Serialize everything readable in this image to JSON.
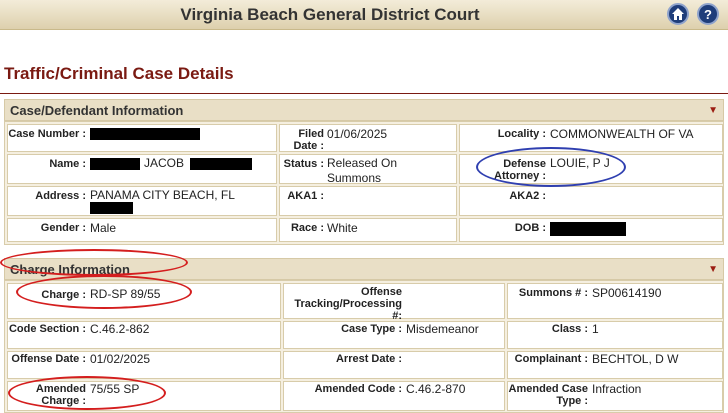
{
  "header": {
    "court_name": "Virginia Beach General District Court",
    "home_icon": "home-icon",
    "help_icon": "?"
  },
  "page_title": "Traffic/Criminal Case Details",
  "case_section": {
    "title": "Case/Defendant Information",
    "case_number_label": "Case Number :",
    "filed_date_label": "Filed Date :",
    "filed_date": "01/06/2025",
    "locality_label": "Locality :",
    "locality": "COMMONWEALTH OF VA",
    "name_label": "Name :",
    "name_visible": "JACOB",
    "status_label": "Status :",
    "status": "Released On Summons",
    "defense_label": "Defense Attorney :",
    "defense": "LOUIE, P J",
    "address_label": "Address :",
    "address": "PANAMA CITY BEACH, FL",
    "aka1_label": "AKA1 :",
    "aka2_label": "AKA2 :",
    "gender_label": "Gender :",
    "gender": "Male",
    "race_label": "Race :",
    "race": "White",
    "dob_label": "DOB :"
  },
  "charge_section": {
    "title": "Charge Information",
    "charge_label": "Charge :",
    "charge": "RD-SP 89/55",
    "offense_tracking_label": "Offense Tracking/Processing #:",
    "summons_label": "Summons # :",
    "summons": "SP00614190",
    "code_section_label": "Code Section :",
    "code_section": "C.46.2-862",
    "case_type_label": "Case Type :",
    "case_type": "Misdemeanor",
    "class_label": "Class :",
    "class": "1",
    "offense_date_label": "Offense Date :",
    "offense_date": "01/02/2025",
    "arrest_date_label": "Arrest Date :",
    "complainant_label": "Complainant :",
    "complainant": "BECHTOL, D W",
    "amended_charge_label": "Amended Charge :",
    "amended_charge": "75/55 SP",
    "amended_code_label": "Amended Code :",
    "amended_code": "C.46.2-870",
    "amended_case_type_label": "Amended Case Type :",
    "amended_case_type": "Infraction"
  }
}
